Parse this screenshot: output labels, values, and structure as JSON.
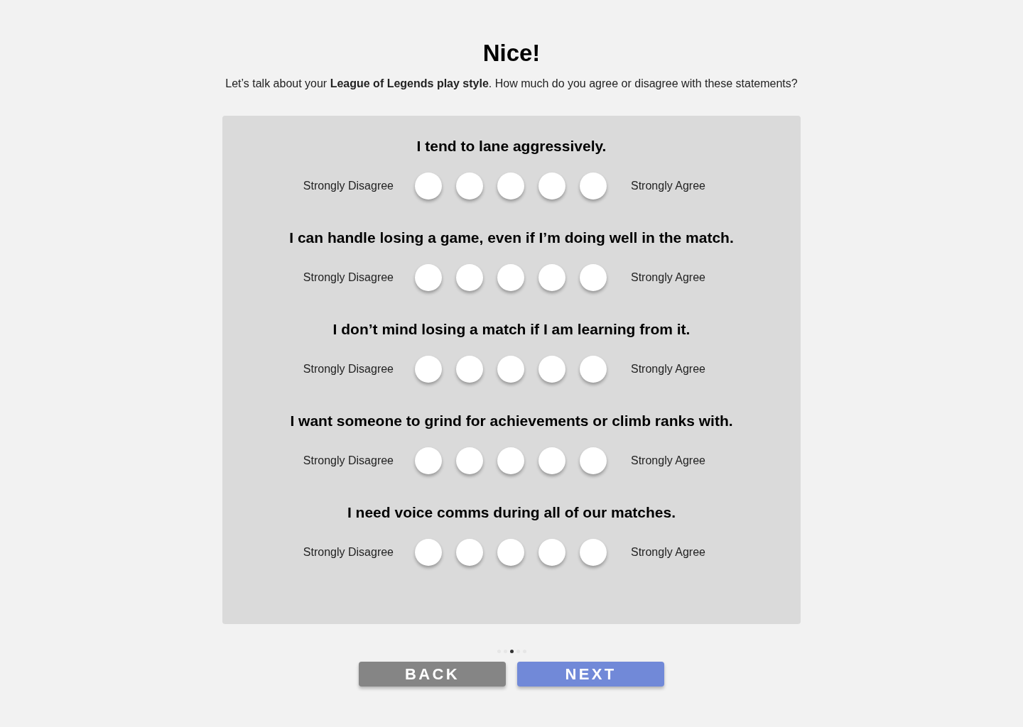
{
  "title": "Nice!",
  "intro": "Let’s talk about your **League of Legends play style**. How much do you agree or disagree with these statements?",
  "statements": [
    {
      "text": "I tend to lane aggressively.",
      "low_label": "Strongly Disagree",
      "high_label": "Strongly Agree",
      "options": [
        {
          "selected": false
        },
        {
          "selected": false
        },
        {
          "selected": false
        },
        {
          "selected": false
        },
        {
          "selected": false
        }
      ]
    },
    {
      "text": "I can handle losing a game, even if I’m doing well in the match.",
      "low_label": "Strongly Disagree",
      "high_label": "Strongly Agree",
      "options": [
        {
          "selected": false
        },
        {
          "selected": false
        },
        {
          "selected": false
        },
        {
          "selected": false
        },
        {
          "selected": false
        }
      ]
    },
    {
      "text": "I don’t mind losing a match if I am learning from it.",
      "low_label": "Strongly Disagree",
      "high_label": "Strongly Agree",
      "options": [
        {
          "selected": false
        },
        {
          "selected": false
        },
        {
          "selected": false
        },
        {
          "selected": false
        },
        {
          "selected": false
        }
      ]
    },
    {
      "text": "I want someone to grind for achievements or climb ranks with.",
      "low_label": "Strongly Disagree",
      "high_label": "Strongly Agree",
      "options": [
        {
          "selected": false
        },
        {
          "selected": false
        },
        {
          "selected": false
        },
        {
          "selected": false
        },
        {
          "selected": false
        }
      ]
    },
    {
      "text": "I need voice comms during all of our matches.",
      "low_label": "Strongly Disagree",
      "high_label": "Strongly Agree",
      "options": [
        {
          "selected": false
        },
        {
          "selected": false
        },
        {
          "selected": false
        },
        {
          "selected": false
        },
        {
          "selected": false
        }
      ]
    }
  ],
  "pages": [
    {
      "selected": false
    },
    {
      "selected": false
    },
    {
      "selected": true
    },
    {
      "selected": false
    },
    {
      "selected": false
    }
  ],
  "buttons": [
    {
      "kind": "back",
      "label": "BACK"
    },
    {
      "kind": "next",
      "label": "NEXT"
    }
  ]
}
